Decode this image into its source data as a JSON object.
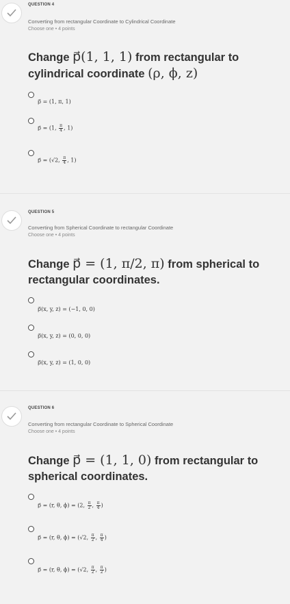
{
  "questions": [
    {
      "number_label": "QUESTION 4",
      "subtitle": "Converting from rectangular Coordinate to Cylindrical Coordinate",
      "meta": "Choose one • 4 points",
      "prompt_text_1": "Change ",
      "prompt_math_1": "p⃗(1, 1, 1)",
      "prompt_text_2": " from rectangular to cylindrical coordinate ",
      "prompt_math_2": "(ρ, ϕ, z)",
      "options": [
        "p⃗ = (1, π, 1)",
        "p⃗ = (1, π/4, 1)",
        "p⃗ = (√2, π/4, 1)"
      ]
    },
    {
      "number_label": "QUESTION 5",
      "subtitle": "Converting from Spherical Coordinate to rectangular Coordinate",
      "meta": "Choose one • 4 points",
      "prompt_text_1": "Change ",
      "prompt_math_1": "p⃗ = (1, π/2, π)",
      "prompt_text_2": " from spherical to rectangular coordinates.",
      "options": [
        "p⃗(x, y, z) = (−1, 0, 0)",
        "p⃗(x, y, z) = (0, 0, 0)",
        "p⃗(x, y, z) = (1, 0, 0)"
      ]
    },
    {
      "number_label": "QUESTION 6",
      "subtitle": "Converting from rectangular Coordinate to Spherical Coordinate",
      "meta": "Choose one • 4 points",
      "prompt_text_1": "Change ",
      "prompt_math_1": "p⃗ = (1, 1, 0)",
      "prompt_text_2": " from rectangular to spherical coordinates.",
      "options": [
        "p⃗ = (r, θ, ϕ) = (2, π/2, π/4)",
        "p⃗ = (r, θ, ϕ) = (√2, π/2, π/4)",
        "p⃗ = (r, θ, ϕ) = (√2, π/2, π/2)"
      ]
    }
  ],
  "icon": "check-icon",
  "colors": {
    "check": "#999999",
    "background": "#f2f2f2"
  }
}
